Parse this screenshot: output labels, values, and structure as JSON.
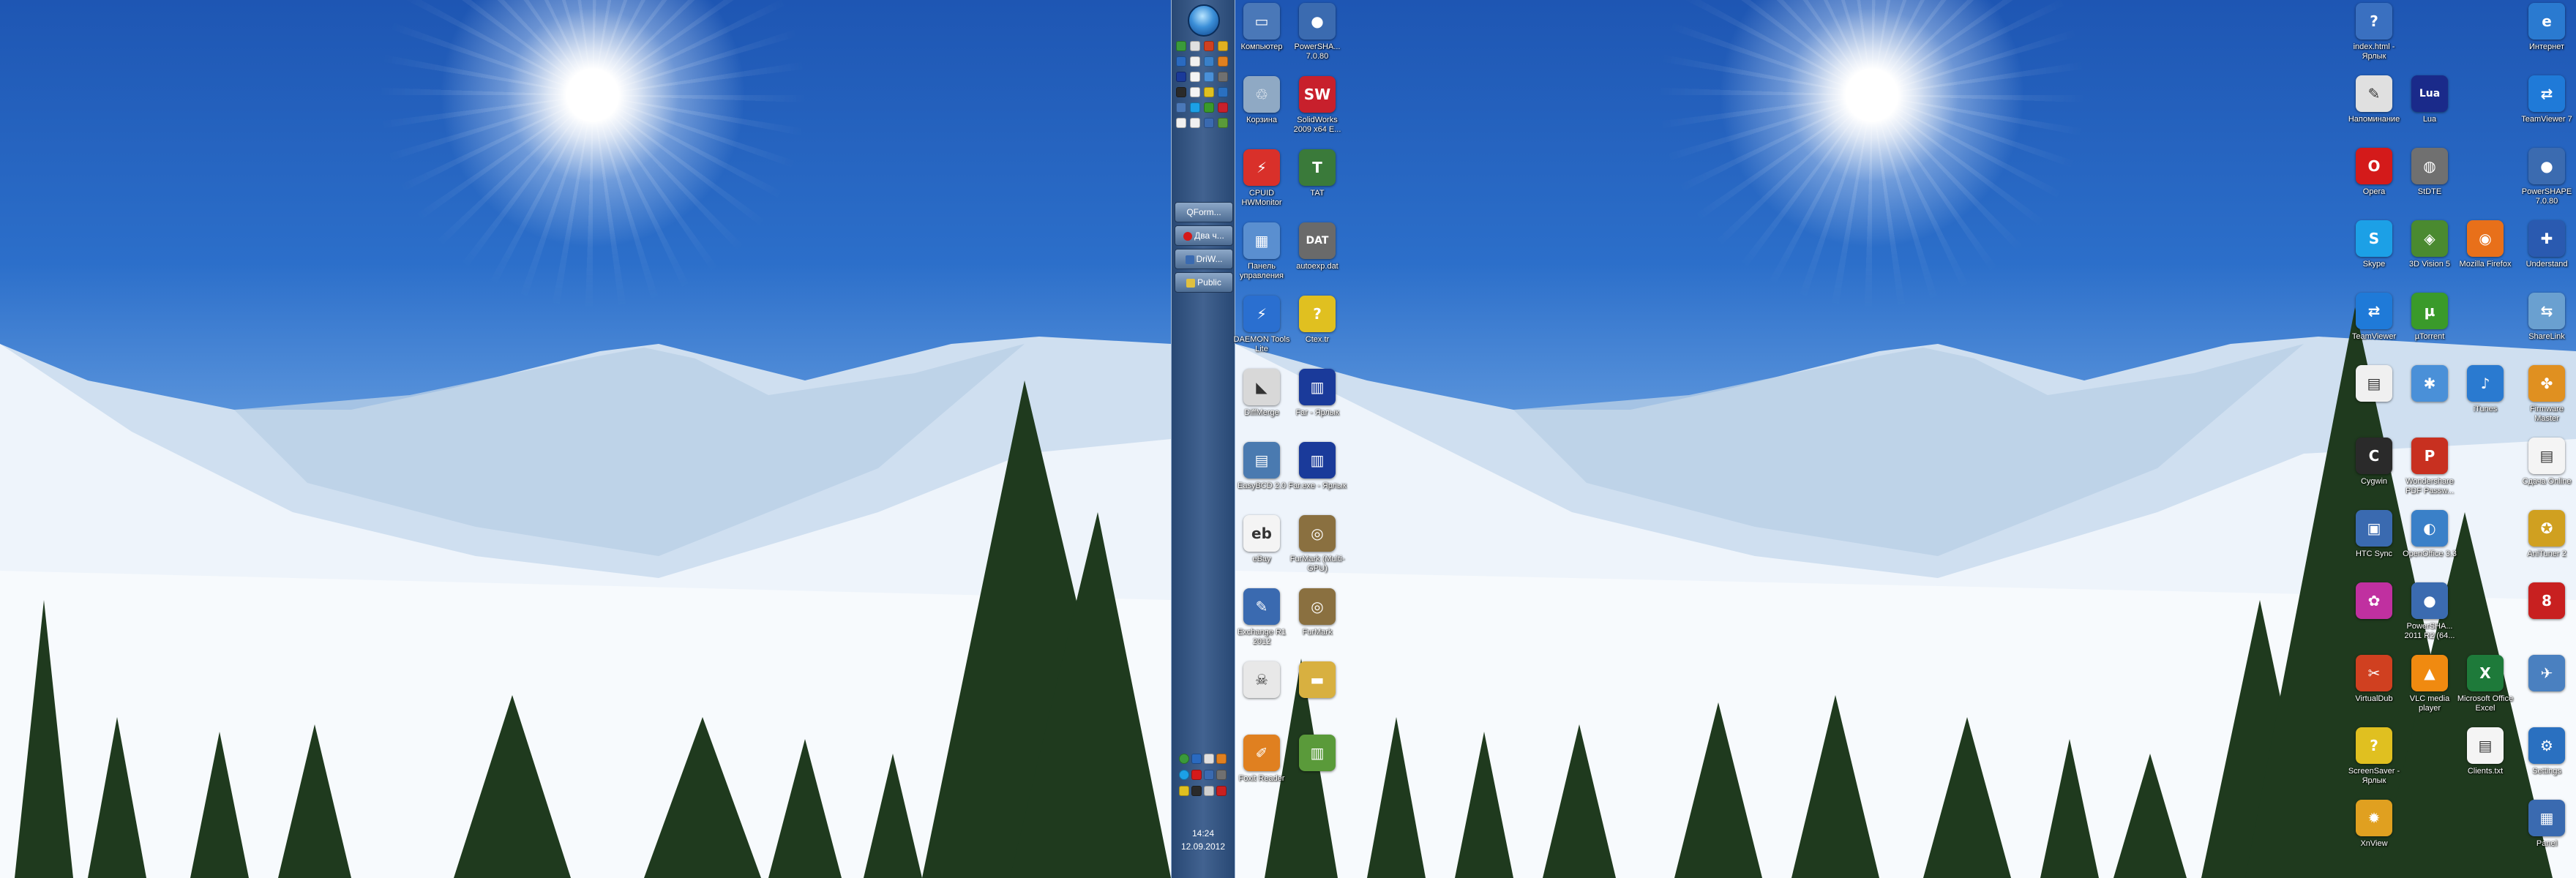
{
  "taskbar": {
    "buttons": [
      "QForm...",
      "Два ч...",
      "DriW...",
      "Public"
    ],
    "clock_time": "14:24",
    "clock_date": "12.09.2012"
  },
  "left_icons": [
    {
      "label": "Компьютер",
      "icon": "computer-icon",
      "color": "#4a78b8",
      "glyph": "▭"
    },
    {
      "label": "PowerSHA... 7.0.80",
      "icon": "powershape-icon",
      "color": "#3b6bb0",
      "glyph": "●"
    },
    {
      "label": "Корзина",
      "icon": "recycle-bin-icon",
      "color": "#8fa9c4",
      "glyph": "♲"
    },
    {
      "label": "SolidWorks 2009 x64 E...",
      "icon": "solidworks-icon",
      "color": "#c8202c",
      "glyph": "SW"
    },
    {
      "label": "CPUID HWMonitor",
      "icon": "hwmonitor-icon",
      "color": "#d9302a",
      "glyph": "⚡"
    },
    {
      "label": "TAT",
      "icon": "tat-icon",
      "color": "#3a7a3a",
      "glyph": "T"
    },
    {
      "label": "Панель управления",
      "icon": "control-panel-icon",
      "color": "#5a8fd0",
      "glyph": "▦"
    },
    {
      "label": "autoexp.dat",
      "icon": "dat-file-icon",
      "color": "#6a6a6a",
      "glyph": "DAT"
    },
    {
      "label": "DAEMON Tools Lite",
      "icon": "daemon-tools-icon",
      "color": "#2a6fd0",
      "glyph": "⚡"
    },
    {
      "label": "Ctex.tr",
      "icon": "unknown-file-icon",
      "color": "#e0c020",
      "glyph": "?"
    },
    {
      "label": "DiffMerge",
      "icon": "diffmerge-icon",
      "color": "#d8d8d8",
      "glyph": "◣"
    },
    {
      "label": "Far - Ярлык",
      "icon": "far-manager-icon",
      "color": "#1a3a9a",
      "glyph": "▥"
    },
    {
      "label": "EasyBCD 2.0",
      "icon": "easybcd-icon",
      "color": "#4a7ab0",
      "glyph": "▤"
    },
    {
      "label": "Far.exe - Ярлык",
      "icon": "far-exe-icon",
      "color": "#1a3a9a",
      "glyph": "▥"
    },
    {
      "label": "eBay",
      "icon": "ebay-icon",
      "color": "#f4f4f4",
      "glyph": "eb"
    },
    {
      "label": "FurMark (Multi-GPU)",
      "icon": "furmark-multi-icon",
      "color": "#8a7040",
      "glyph": "◎"
    },
    {
      "label": "Exchange R1 2012",
      "icon": "exchange-icon",
      "color": "#3a6ab0",
      "glyph": "✎"
    },
    {
      "label": "FurMark",
      "icon": "furmark-icon",
      "color": "#8a7040",
      "glyph": "◎"
    },
    {
      "label": "",
      "icon": "skull-icon",
      "color": "#e8e8e8",
      "glyph": "☠"
    },
    {
      "label": "",
      "icon": "folder-icon",
      "color": "#d8b040",
      "glyph": "▬"
    },
    {
      "label": "Foxit Reader",
      "icon": "foxit-reader-icon",
      "color": "#e08020",
      "glyph": "✐"
    },
    {
      "label": "",
      "icon": "chart-app-icon",
      "color": "#5a9a3a",
      "glyph": "▥"
    }
  ],
  "right_icons": [
    {
      "label": "index.html - Ярлык",
      "icon": "help-file-icon",
      "color": "#3a70c0",
      "glyph": "?"
    },
    {
      "label": "Интернет",
      "icon": "internet-explorer-icon",
      "color": "#2a7ad0",
      "glyph": "e"
    },
    {
      "label": "Напоминание",
      "icon": "notes-icon",
      "color": "#e0e0e0",
      "glyph": "✎"
    },
    {
      "label": "Lua",
      "icon": "lua-icon",
      "color": "#1a2a8a",
      "glyph": "Lua"
    },
    {
      "label": "TeamViewer 7",
      "icon": "teamviewer-icon",
      "color": "#1f7ad8",
      "glyph": "⇄"
    },
    {
      "label": "Opera",
      "icon": "opera-icon",
      "color": "#d41a1a",
      "glyph": "O"
    },
    {
      "label": "StDTE",
      "icon": "stdte-icon",
      "color": "#707070",
      "glyph": "◍"
    },
    {
      "label": "PowerSHAPE 7.0.80",
      "icon": "powershape-icon",
      "color": "#3b6bb0",
      "glyph": "●"
    },
    {
      "label": "Skype",
      "icon": "skype-icon",
      "color": "#1ca0e6",
      "glyph": "S"
    },
    {
      "label": "3D Vision 5",
      "icon": "3d-vision-icon",
      "color": "#4a8a30",
      "glyph": "◈"
    },
    {
      "label": "Mozilla Firefox",
      "icon": "firefox-icon",
      "color": "#e8701a",
      "glyph": "◉"
    },
    {
      "label": "Understand",
      "icon": "understand-icon",
      "color": "#2a5ab0",
      "glyph": "✚"
    },
    {
      "label": "TeamViewer",
      "icon": "teamviewer-icon",
      "color": "#1f7ad8",
      "glyph": "⇄"
    },
    {
      "label": "µTorrent",
      "icon": "utorrent-icon",
      "color": "#3a9a2a",
      "glyph": "µ"
    },
    {
      "label": "ShareLink",
      "icon": "sharelink-icon",
      "color": "#6aa0d0",
      "glyph": "⇆"
    },
    {
      "label": "",
      "icon": "document-icon",
      "color": "#f0f0f0",
      "glyph": "▤"
    },
    {
      "label": "",
      "icon": "app-blue-icon",
      "color": "#4a90d8",
      "glyph": "✱"
    },
    {
      "label": "iTunes",
      "icon": "itunes-icon",
      "color": "#2a7ad0",
      "glyph": "♪"
    },
    {
      "label": "Firmware Master",
      "icon": "firmware-icon",
      "color": "#e09020",
      "glyph": "✤"
    },
    {
      "label": "Cygwin",
      "icon": "cygwin-icon",
      "color": "#2a2a2a",
      "glyph": "C"
    },
    {
      "label": "Wondershare PDF Passw...",
      "icon": "pdf-icon",
      "color": "#c83020",
      "glyph": "P"
    },
    {
      "label": "Сдача Online",
      "icon": "text-file-icon",
      "color": "#f4f4f4",
      "glyph": "▤"
    },
    {
      "label": "HTC Sync",
      "icon": "htc-sync-icon",
      "color": "#3a6ab0",
      "glyph": "▣"
    },
    {
      "label": "OpenOffice 3.3",
      "icon": "openoffice-icon",
      "color": "#3a80c8",
      "glyph": "◐"
    },
    {
      "label": "AniTuner 2",
      "icon": "anituner-icon",
      "color": "#d0a020",
      "glyph": "✪"
    },
    {
      "label": "",
      "icon": "color-app-icon",
      "color": "#c030a0",
      "glyph": "✿"
    },
    {
      "label": "PowerSHA... 2011 R2 (64...",
      "icon": "powershape-icon",
      "color": "#3b6bb0",
      "glyph": "●"
    },
    {
      "label": "",
      "icon": "red-app-icon",
      "color": "#c82020",
      "glyph": "8"
    },
    {
      "label": "VirtualDub",
      "icon": "virtualdub-icon",
      "color": "#d04020",
      "glyph": "✂"
    },
    {
      "label": "VLC media player",
      "icon": "vlc-icon",
      "color": "#f08a10",
      "glyph": "▲"
    },
    {
      "label": "Microsoft Office Excel",
      "icon": "excel-icon",
      "color": "#1e7a3a",
      "glyph": "X"
    },
    {
      "label": "",
      "icon": "bird-icon",
      "color": "#4a80c0",
      "glyph": "✈"
    },
    {
      "label": "ScreenSaver - Ярлык",
      "icon": "shortcut-icon",
      "color": "#e0c020",
      "glyph": "?"
    },
    {
      "label": "Clients.txt",
      "icon": "txt-file-icon",
      "color": "#f4f4f4",
      "glyph": "▤"
    },
    {
      "label": "Settings",
      "icon": "settings-gear-icon",
      "color": "#2a70c0",
      "glyph": "⚙"
    },
    {
      "label": "XnView",
      "icon": "xnview-icon",
      "color": "#e0a020",
      "glyph": "✹"
    },
    {
      "label": "Panel",
      "icon": "panel-app-icon",
      "color": "#3a6ab0",
      "glyph": "▦"
    }
  ]
}
